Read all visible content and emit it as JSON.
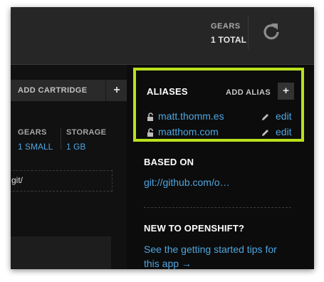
{
  "header": {
    "gears_label": "GEARS",
    "gears_total": "1 TOTAL",
    "refresh_icon": "refresh-icon"
  },
  "cartridge": {
    "add_cartridge_label": "ADD CARTRIDGE",
    "add_plus": "+",
    "gears_label": "GEARS",
    "gears_value": "1 SMALL",
    "storage_label": "STORAGE",
    "storage_value": "1 GB",
    "git_url_fragment": "git/"
  },
  "aliases": {
    "title": "ALIASES",
    "add_alias_label": "ADD ALIAS",
    "add_plus": "+",
    "items": [
      {
        "name": "matt.thomm.es",
        "edit": "edit"
      },
      {
        "name": "matthom.com",
        "edit": "edit"
      }
    ]
  },
  "based_on": {
    "title": "BASED ON",
    "link": "git://github.com/o…"
  },
  "new_to_openshift": {
    "title": "NEW TO OPENSHIFT?",
    "link_text": "See the getting started tips for this app →"
  },
  "colors": {
    "accent_link": "#4ea6e0",
    "highlight_border": "#b9e11d",
    "background": "#0c0c0c"
  }
}
